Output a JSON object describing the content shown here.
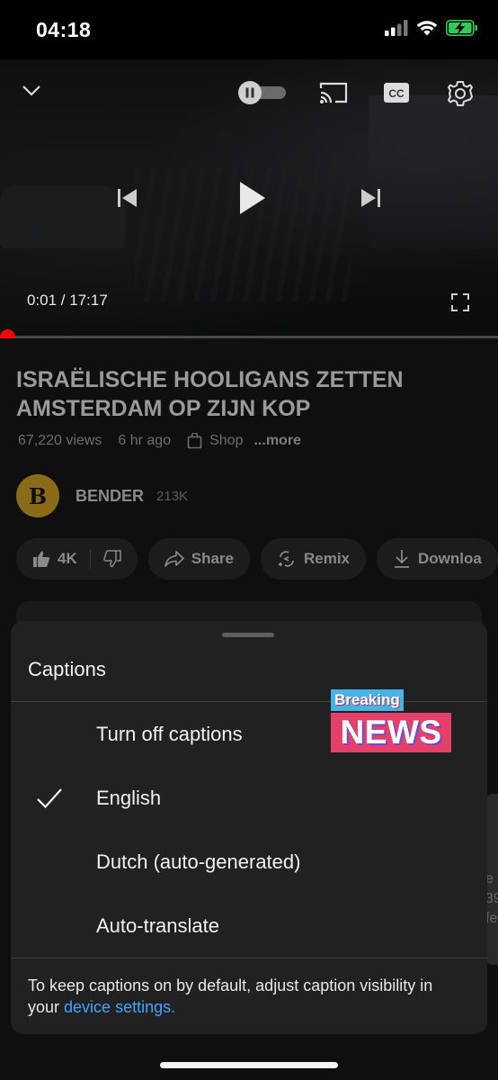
{
  "status_bar": {
    "time": "04:18"
  },
  "video": {
    "time_display": "0:01 / 17:17",
    "progress_fraction": 0.001
  },
  "details": {
    "title": "ISRAËLISCHE HOOLIGANS ZETTEN AMSTERDAM OP ZIJN KOP",
    "views": "67,220 views",
    "age": "6 hr ago",
    "shop": "Shop",
    "more": "...more",
    "channel_avatar_letter": "B",
    "channel_name": "BENDER",
    "subscribers": "213K",
    "actions": {
      "like_count": "4K",
      "share": "Share",
      "remix": "Remix",
      "download": "Downloa"
    },
    "side_text": "e\n39\nfe"
  },
  "captions_sheet": {
    "title": "Captions",
    "options": [
      {
        "label": "Turn off captions",
        "selected": false
      },
      {
        "label": "English",
        "selected": true
      },
      {
        "label": "Dutch (auto-generated)",
        "selected": false
      },
      {
        "label": "Auto-translate",
        "selected": false
      }
    ],
    "footer_text": "To keep captions on by default, adjust caption visibility in your ",
    "footer_link": "device settings."
  },
  "overlay": {
    "breaking": "Breaking",
    "news": "NEWS"
  },
  "colors": {
    "accent_link": "#3ea6ff",
    "progress": "#ff0000",
    "battery": "#34c759",
    "sheet_bg": "#212121"
  }
}
